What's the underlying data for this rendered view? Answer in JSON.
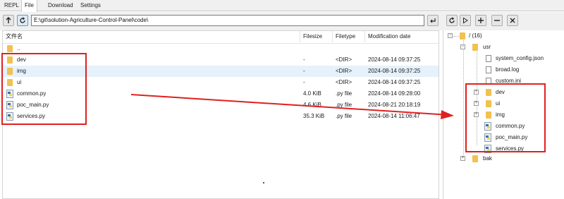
{
  "tabs": [
    {
      "label": "REPL",
      "active": false
    },
    {
      "label": "File",
      "active": true
    },
    {
      "label": "Download",
      "active": false
    },
    {
      "label": "Settings",
      "active": false
    }
  ],
  "toolbar": {
    "path_value": "E:\\git\\solution-Agriculture-Control-Panel\\code\\",
    "icons": [
      "arrow-up-icon",
      "refresh-icon",
      "enter-icon",
      "refresh-icon",
      "play-icon",
      "plus-icon",
      "minus-icon",
      "close-icon"
    ]
  },
  "file_list": {
    "columns": [
      "文件名",
      "Filesize",
      "Filetype",
      "Modification date"
    ],
    "rows": [
      {
        "name": "..",
        "type": "folder",
        "size": "",
        "filetype": "",
        "date": ""
      },
      {
        "name": "dev",
        "type": "folder",
        "size": "-",
        "filetype": "<DIR>",
        "date": "2024-08-14 09:37:25"
      },
      {
        "name": "img",
        "type": "folder",
        "size": "-",
        "filetype": "<DIR>",
        "date": "2024-08-14 09:37:25",
        "selected": true
      },
      {
        "name": "ui",
        "type": "folder",
        "size": "-",
        "filetype": "<DIR>",
        "date": "2024-08-14 09:37:25"
      },
      {
        "name": "common.py",
        "type": "python",
        "size": "4.0 KiB",
        "filetype": ".py file",
        "date": "2024-08-14 09:28:00"
      },
      {
        "name": "poc_main.py",
        "type": "python",
        "size": "4.6 KiB",
        "filetype": ".py file",
        "date": "2024-08-21 20:18:19"
      },
      {
        "name": "services.py",
        "type": "python",
        "size": "35.3 KiB",
        "filetype": ".py file",
        "date": "2024-08-14 11:06:47"
      }
    ]
  },
  "tree": {
    "root": "/ (16)",
    "usr": "usr",
    "usr_files": [
      "system_config.json",
      "broad.log",
      "custom.ini"
    ],
    "usr_folders": [
      "dev",
      "ui",
      "img"
    ],
    "usr_py": [
      "common.py",
      "poc_main.py",
      "services.py"
    ],
    "bak": "bak"
  },
  "colors": {
    "annotation_red": "#e02020",
    "folder_yellow": "#f2c14e",
    "selected_row": "#e5f1fb"
  }
}
